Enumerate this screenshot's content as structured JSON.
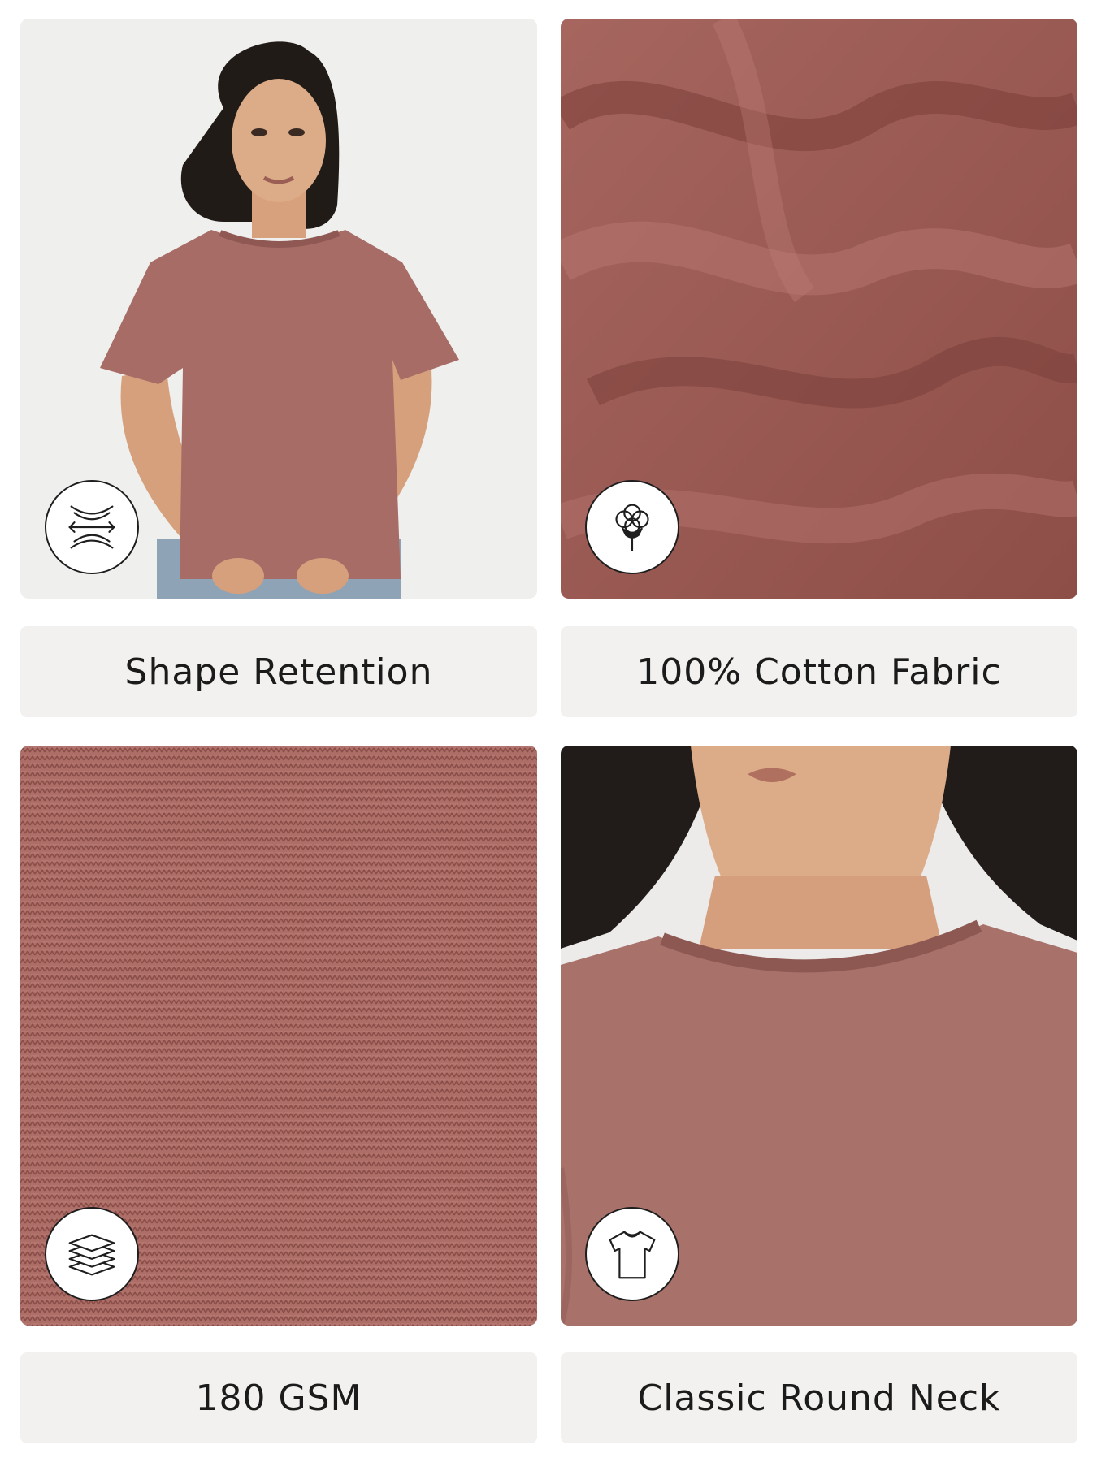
{
  "colors": {
    "tile_background": "#efefef",
    "fabric": "#a8665f",
    "caption_background": "#f2f1ef",
    "caption_text": "#1b1b1b",
    "icon_stroke": "#1e1e1e"
  },
  "features": [
    {
      "label": "Shape Retention",
      "icon": "stretch-arrows-icon",
      "image": "model-front-photo"
    },
    {
      "label": "100% Cotton Fabric",
      "icon": "cotton-flower-icon",
      "image": "fabric-drape-closeup"
    },
    {
      "label": "180 GSM",
      "icon": "layers-icon",
      "image": "fabric-knit-texture"
    },
    {
      "label": "Classic Round Neck",
      "icon": "tshirt-icon",
      "image": "neckline-closeup"
    }
  ]
}
